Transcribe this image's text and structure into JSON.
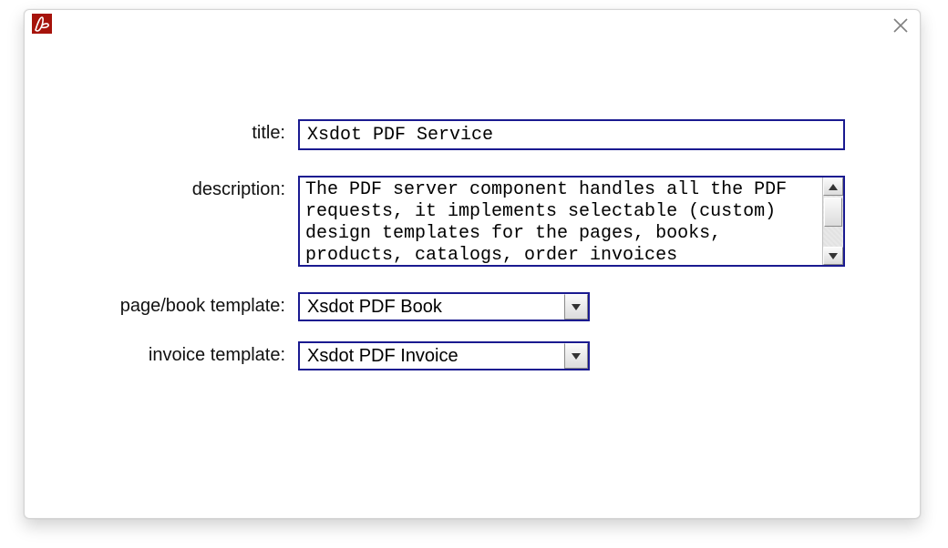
{
  "header": {
    "app_icon": "adobe-pdf-icon",
    "close_label": "Close"
  },
  "form": {
    "title": {
      "label": "title:",
      "value": "Xsdot PDF Service"
    },
    "description": {
      "label": "description:",
      "value": "The PDF server component handles all the PDF requests, it implements selectable (custom) design templates for the pages, books, products, catalogs, order invoices"
    },
    "page_book_template": {
      "label": "page/book template:",
      "value": "Xsdot PDF Book"
    },
    "invoice_template": {
      "label": "invoice template:",
      "value": "Xsdot PDF Invoice"
    }
  }
}
